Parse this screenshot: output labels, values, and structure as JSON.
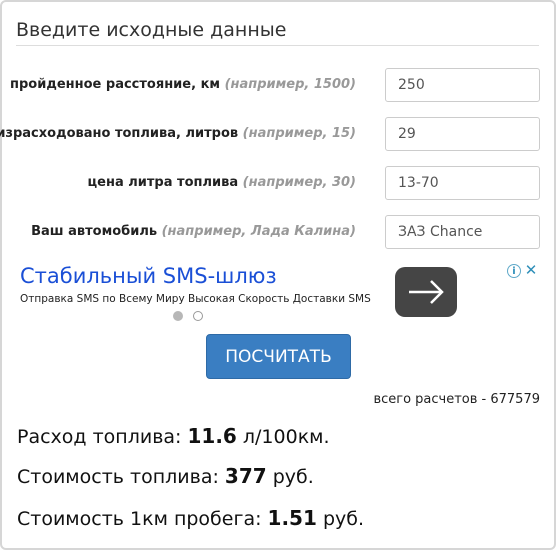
{
  "form": {
    "title": "Введите исходные данные",
    "fields": [
      {
        "label": "пройденное расстояние, км",
        "hint": "(например, 1500)",
        "value": "250"
      },
      {
        "label": "израсходовано топлива, литров",
        "hint": "(например, 15)",
        "value": "29"
      },
      {
        "label": "цена литра топлива",
        "hint": "(например, 30)",
        "value": "13-70"
      },
      {
        "label": "Ваш автомобиль",
        "hint": "(например, Лада Калина)",
        "value": "ЗАЗ Chance"
      }
    ]
  },
  "ad": {
    "title": "Стабильный SMS-шлюз",
    "text": "Отправка SMS по Всему Миру Высокая Скорость Доставки SMS",
    "info_icon": "info-icon",
    "close_icon": "close-icon",
    "arrow_icon": "arrow-right-icon"
  },
  "calculate": {
    "button_label": "ПОСЧИТАТЬ",
    "count_text": "всего расчетов - 677579"
  },
  "results": [
    {
      "prefix": "Расход топлива: ",
      "value": "11.6",
      "unit": " л/100км."
    },
    {
      "prefix": "Стоимость топлива: ",
      "value": "377",
      "unit": " руб."
    },
    {
      "prefix": "Стоимость 1км пробега: ",
      "value": "1.51",
      "unit": " руб."
    }
  ],
  "colors": {
    "button": "#3a7ec2",
    "ad_title": "#1a4fd6",
    "hint": "#999999"
  }
}
